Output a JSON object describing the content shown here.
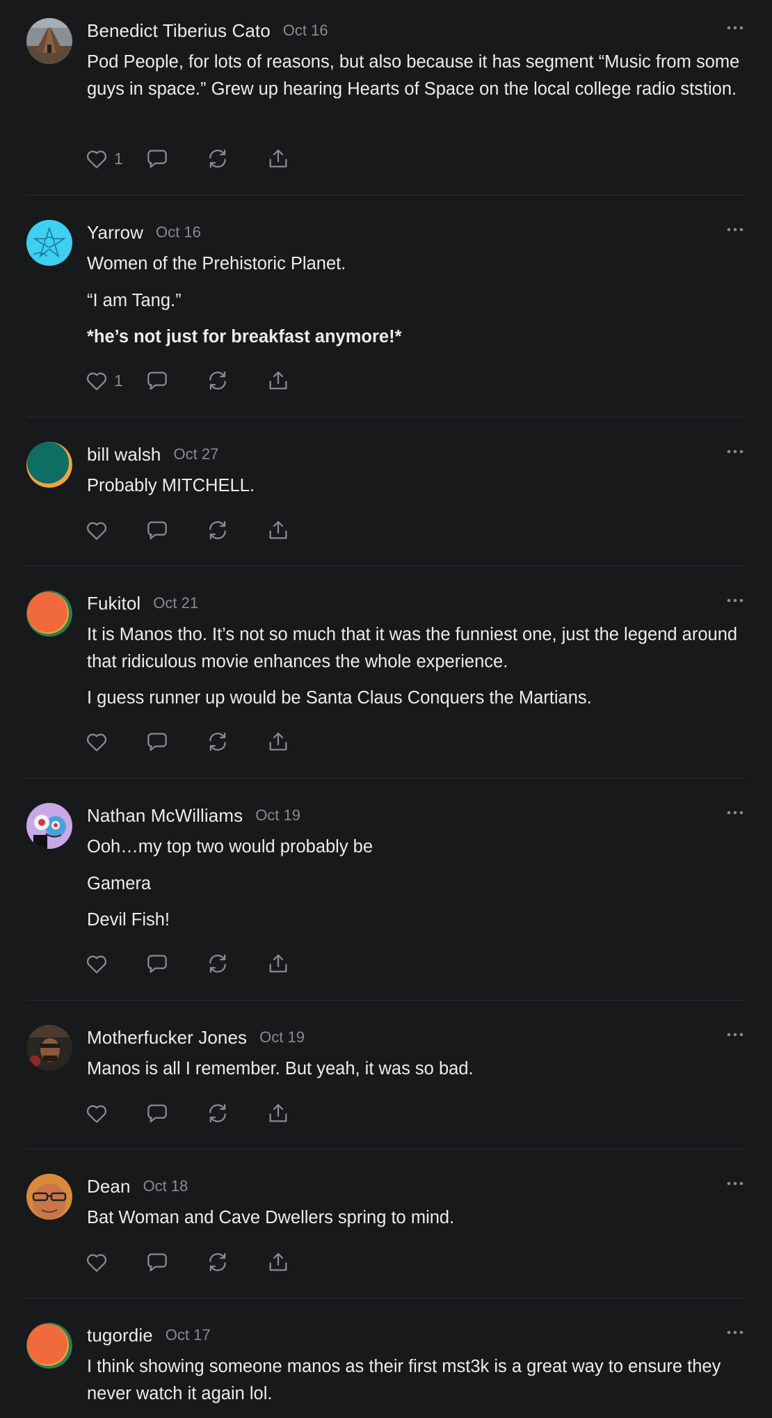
{
  "colors": {
    "background": "#18191b",
    "text": "#ececed",
    "muted": "#8a8b8f",
    "divider": "#2c2d30"
  },
  "icons": {
    "like": "heart-icon",
    "reply": "speech-bubble-icon",
    "restack": "restack-arrows-icon",
    "share": "share-upload-icon",
    "more": "ellipsis-icon"
  },
  "comments": [
    {
      "author": "Benedict Tiberius Cato",
      "date": "Oct 16",
      "avatar": "tent photo",
      "paragraphs": [
        "Pod People, for lots of reasons, but also because it has segment “Music from some guys in space.” Grew up hearing Hearts of Space on the local college radio ststion."
      ],
      "likes": "1"
    },
    {
      "author": "Yarrow",
      "date": "Oct 16",
      "avatar": "cyan star drawing",
      "paragraphs": [
        "Women of the Prehistoric Planet.",
        "“I am Tang.”",
        "*he’s not just for breakfast anymore!*"
      ],
      "likes": "1"
    },
    {
      "author": "bill walsh",
      "date": "Oct 27",
      "avatar": "teal circle",
      "paragraphs": [
        "Probably MITCHELL."
      ],
      "likes": ""
    },
    {
      "author": "Fukitol",
      "date": "Oct 21",
      "avatar": "orange circle",
      "paragraphs": [
        "It is Manos tho. It’s not so much that it was the funniest one, just the legend around that ridiculous movie enhances the whole experience.",
        "I guess runner up would be Santa Claus Conquers the Martians."
      ],
      "likes": ""
    },
    {
      "author": "Nathan McWilliams",
      "date": "Oct 19",
      "avatar": "cartoon character",
      "paragraphs": [
        "Ooh…my top two would probably be",
        "Gamera",
        "Devil Fish!"
      ],
      "likes": ""
    },
    {
      "author": "Motherfucker Jones",
      "date": "Oct 19",
      "avatar": "person photo",
      "paragraphs": [
        "Manos is all I remember. But yeah, it was so bad."
      ],
      "likes": ""
    },
    {
      "author": "Dean",
      "date": "Oct 18",
      "avatar": "face with glasses",
      "paragraphs": [
        "Bat Woman and Cave Dwellers spring to mind."
      ],
      "likes": ""
    },
    {
      "author": "tugordie",
      "date": "Oct 17",
      "avatar": "orange circle",
      "paragraphs": [
        "I think showing someone manos as their first mst3k is a great way to ensure they never watch it again lol."
      ],
      "likes": ""
    }
  ]
}
